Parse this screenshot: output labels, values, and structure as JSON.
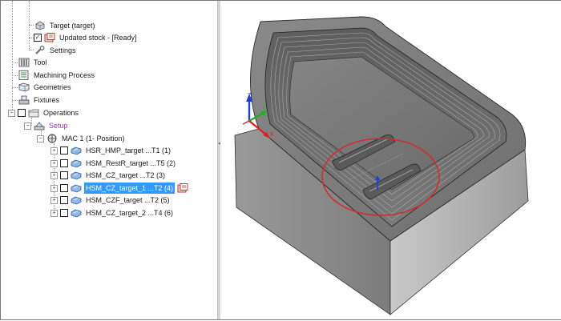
{
  "tree": {
    "items": [
      {
        "label": "Target (target)"
      },
      {
        "label": "Updated stock - [Ready]"
      },
      {
        "label": "Settings"
      },
      {
        "label": "Tool"
      },
      {
        "label": "Machining Process"
      },
      {
        "label": "Geometries"
      },
      {
        "label": "Fixtures"
      },
      {
        "label": "Operations"
      },
      {
        "label": "Setup"
      },
      {
        "label": "MAC 1 (1- Position)"
      },
      {
        "label": "HSR_HMP_target ...T1 (1)"
      },
      {
        "label": "HSM_RestR_target ...T5 (2)"
      },
      {
        "label": "HSM_CZ_target ...T2 (3)"
      },
      {
        "label": "HSM_CZ_target_1 ...T2 (4)"
      },
      {
        "label": "HSM_CZF_target ...T2 (5)"
      },
      {
        "label": "HSM_CZ_target_2 ...T4 (6)"
      }
    ],
    "expand_plus": "+",
    "expand_minus": "−",
    "check_mark": "✓"
  },
  "viewport": {
    "axes": {
      "x": "X",
      "y": "Y",
      "z": "Z"
    },
    "colors": {
      "setup_label": "#9b30d9",
      "selection": "#3399ff",
      "highlight_circle": "#d42c2c",
      "axis_x": "#e02020",
      "axis_y": "#20b020",
      "axis_z": "#1b3fd6"
    }
  },
  "splitter": {
    "grip": "◂"
  }
}
